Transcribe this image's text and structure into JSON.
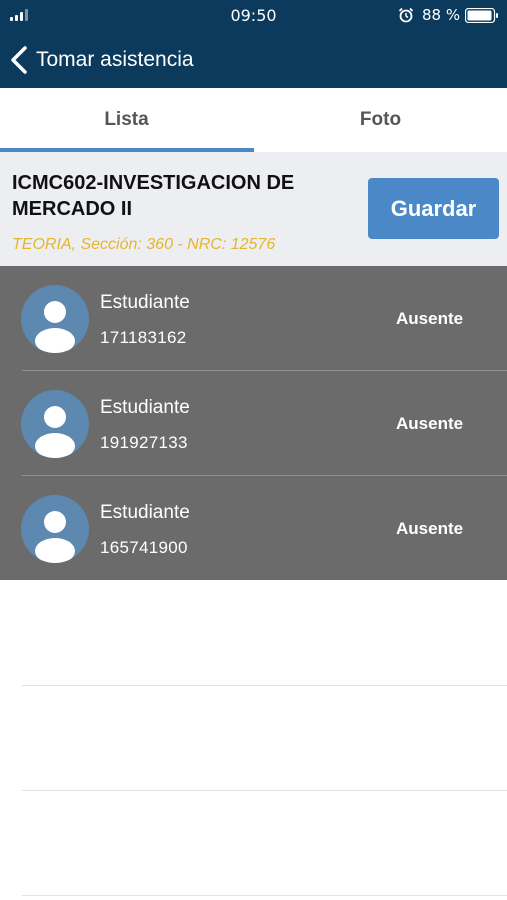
{
  "status_bar": {
    "time": "09:50",
    "battery_percent": "88 %",
    "icons": [
      "signal-icon",
      "alarm-icon",
      "battery-icon"
    ]
  },
  "nav": {
    "title": "Tomar asistencia",
    "back_icon": "chevron-left-icon"
  },
  "tabs": [
    {
      "label": "Lista",
      "active": true
    },
    {
      "label": "Foto",
      "active": false
    }
  ],
  "course": {
    "title": "ICMC602-INVESTIGACION DE MERCADO II",
    "subtitle": "TEORIA, Sección: 360 - NRC: 12576",
    "save_label": "Guardar"
  },
  "students": [
    {
      "name": "Estudiante",
      "id": "171183162",
      "status": "Ausente"
    },
    {
      "name": "Estudiante",
      "id": "191927133",
      "status": "Ausente"
    },
    {
      "name": "Estudiante",
      "id": "165741900",
      "status": "Ausente"
    }
  ],
  "colors": {
    "header_bg": "#0b3a5c",
    "accent": "#4a88c8",
    "subtitle": "#e6b52e",
    "list_bg": "#6b6b6b"
  }
}
